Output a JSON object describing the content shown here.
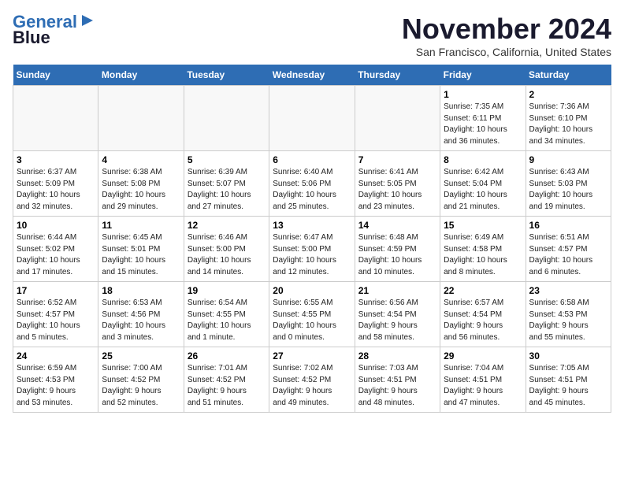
{
  "logo": {
    "line1": "General",
    "line2": "Blue"
  },
  "title": "November 2024",
  "subtitle": "San Francisco, California, United States",
  "weekdays": [
    "Sunday",
    "Monday",
    "Tuesday",
    "Wednesday",
    "Thursday",
    "Friday",
    "Saturday"
  ],
  "weeks": [
    [
      {
        "day": "",
        "info": ""
      },
      {
        "day": "",
        "info": ""
      },
      {
        "day": "",
        "info": ""
      },
      {
        "day": "",
        "info": ""
      },
      {
        "day": "",
        "info": ""
      },
      {
        "day": "1",
        "info": "Sunrise: 7:35 AM\nSunset: 6:11 PM\nDaylight: 10 hours\nand 36 minutes."
      },
      {
        "day": "2",
        "info": "Sunrise: 7:36 AM\nSunset: 6:10 PM\nDaylight: 10 hours\nand 34 minutes."
      }
    ],
    [
      {
        "day": "3",
        "info": "Sunrise: 6:37 AM\nSunset: 5:09 PM\nDaylight: 10 hours\nand 32 minutes."
      },
      {
        "day": "4",
        "info": "Sunrise: 6:38 AM\nSunset: 5:08 PM\nDaylight: 10 hours\nand 29 minutes."
      },
      {
        "day": "5",
        "info": "Sunrise: 6:39 AM\nSunset: 5:07 PM\nDaylight: 10 hours\nand 27 minutes."
      },
      {
        "day": "6",
        "info": "Sunrise: 6:40 AM\nSunset: 5:06 PM\nDaylight: 10 hours\nand 25 minutes."
      },
      {
        "day": "7",
        "info": "Sunrise: 6:41 AM\nSunset: 5:05 PM\nDaylight: 10 hours\nand 23 minutes."
      },
      {
        "day": "8",
        "info": "Sunrise: 6:42 AM\nSunset: 5:04 PM\nDaylight: 10 hours\nand 21 minutes."
      },
      {
        "day": "9",
        "info": "Sunrise: 6:43 AM\nSunset: 5:03 PM\nDaylight: 10 hours\nand 19 minutes."
      }
    ],
    [
      {
        "day": "10",
        "info": "Sunrise: 6:44 AM\nSunset: 5:02 PM\nDaylight: 10 hours\nand 17 minutes."
      },
      {
        "day": "11",
        "info": "Sunrise: 6:45 AM\nSunset: 5:01 PM\nDaylight: 10 hours\nand 15 minutes."
      },
      {
        "day": "12",
        "info": "Sunrise: 6:46 AM\nSunset: 5:00 PM\nDaylight: 10 hours\nand 14 minutes."
      },
      {
        "day": "13",
        "info": "Sunrise: 6:47 AM\nSunset: 5:00 PM\nDaylight: 10 hours\nand 12 minutes."
      },
      {
        "day": "14",
        "info": "Sunrise: 6:48 AM\nSunset: 4:59 PM\nDaylight: 10 hours\nand 10 minutes."
      },
      {
        "day": "15",
        "info": "Sunrise: 6:49 AM\nSunset: 4:58 PM\nDaylight: 10 hours\nand 8 minutes."
      },
      {
        "day": "16",
        "info": "Sunrise: 6:51 AM\nSunset: 4:57 PM\nDaylight: 10 hours\nand 6 minutes."
      }
    ],
    [
      {
        "day": "17",
        "info": "Sunrise: 6:52 AM\nSunset: 4:57 PM\nDaylight: 10 hours\nand 5 minutes."
      },
      {
        "day": "18",
        "info": "Sunrise: 6:53 AM\nSunset: 4:56 PM\nDaylight: 10 hours\nand 3 minutes."
      },
      {
        "day": "19",
        "info": "Sunrise: 6:54 AM\nSunset: 4:55 PM\nDaylight: 10 hours\nand 1 minute."
      },
      {
        "day": "20",
        "info": "Sunrise: 6:55 AM\nSunset: 4:55 PM\nDaylight: 10 hours\nand 0 minutes."
      },
      {
        "day": "21",
        "info": "Sunrise: 6:56 AM\nSunset: 4:54 PM\nDaylight: 9 hours\nand 58 minutes."
      },
      {
        "day": "22",
        "info": "Sunrise: 6:57 AM\nSunset: 4:54 PM\nDaylight: 9 hours\nand 56 minutes."
      },
      {
        "day": "23",
        "info": "Sunrise: 6:58 AM\nSunset: 4:53 PM\nDaylight: 9 hours\nand 55 minutes."
      }
    ],
    [
      {
        "day": "24",
        "info": "Sunrise: 6:59 AM\nSunset: 4:53 PM\nDaylight: 9 hours\nand 53 minutes."
      },
      {
        "day": "25",
        "info": "Sunrise: 7:00 AM\nSunset: 4:52 PM\nDaylight: 9 hours\nand 52 minutes."
      },
      {
        "day": "26",
        "info": "Sunrise: 7:01 AM\nSunset: 4:52 PM\nDaylight: 9 hours\nand 51 minutes."
      },
      {
        "day": "27",
        "info": "Sunrise: 7:02 AM\nSunset: 4:52 PM\nDaylight: 9 hours\nand 49 minutes."
      },
      {
        "day": "28",
        "info": "Sunrise: 7:03 AM\nSunset: 4:51 PM\nDaylight: 9 hours\nand 48 minutes."
      },
      {
        "day": "29",
        "info": "Sunrise: 7:04 AM\nSunset: 4:51 PM\nDaylight: 9 hours\nand 47 minutes."
      },
      {
        "day": "30",
        "info": "Sunrise: 7:05 AM\nSunset: 4:51 PM\nDaylight: 9 hours\nand 45 minutes."
      }
    ]
  ]
}
